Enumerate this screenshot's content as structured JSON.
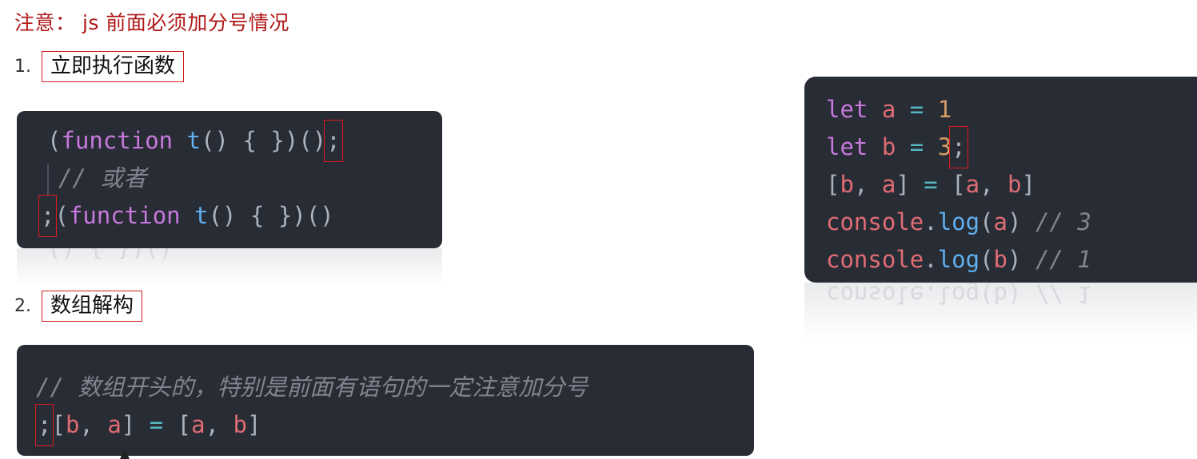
{
  "title": "注意： js 前面必须加分号情况",
  "items": [
    {
      "num": "1.",
      "label": "立即执行函数"
    },
    {
      "num": "2.",
      "label": "数组解构"
    }
  ],
  "code_iife": {
    "l1": [
      "(",
      "function",
      " ",
      "t",
      "() { })()",
      ";"
    ],
    "l2_comment": "// 或者",
    "l3": [
      ";",
      "(",
      "function",
      " ",
      "t",
      "() { })()"
    ]
  },
  "code_destructure": {
    "comment": "// 数组开头的，特别是前面有语句的一定注意加分号",
    "l2": [
      ";",
      "[",
      "b",
      ", ",
      "a",
      "] ",
      "=",
      " [",
      "a",
      ", ",
      "b",
      "]"
    ]
  },
  "code_example": {
    "l1": [
      "let",
      " ",
      "a",
      " ",
      "=",
      " ",
      "1"
    ],
    "l2": [
      "let",
      " ",
      "b",
      " ",
      "=",
      " ",
      "3",
      ";"
    ],
    "l3": [
      "[",
      "b",
      ", ",
      "a",
      "] ",
      "=",
      " [",
      "a",
      ", ",
      "b",
      "]"
    ],
    "l4": [
      "console",
      ".",
      "log",
      "(",
      "a",
      ") ",
      "// 3"
    ],
    "l5": [
      "console",
      ".",
      "log",
      "(",
      "b",
      ") ",
      "// 1"
    ]
  },
  "colors": {
    "title": "#b01818",
    "highlight_box": "#e0191d",
    "code_bg": "#282c34",
    "keyword": "#c678dd",
    "function": "#61afef",
    "variable": "#e06c75",
    "number": "#d19a66",
    "comment": "#7f848e"
  }
}
